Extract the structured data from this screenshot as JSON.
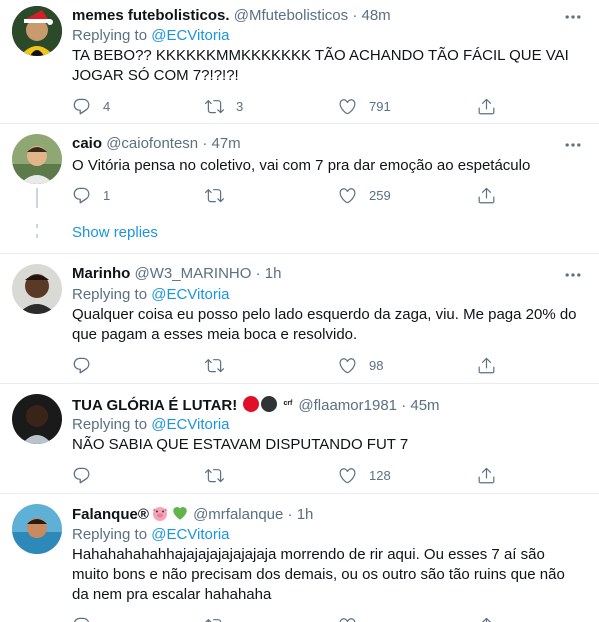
{
  "tweets": [
    {
      "name": "memes futebolisticos.",
      "handle": "@Mfutebolisticos",
      "sep": "·",
      "time": "48m",
      "replying_label": "Replying to",
      "replying_to": "@ECVitoria",
      "text_lines": [
        "TA BEBO?? KKKKKKMMKKKKKKK TÃO ACHANDO TÃO FÁCIL QUE VAI",
        "JOGAR SÓ COM 7?!?!?!"
      ],
      "replies": "4",
      "retweets": "3",
      "likes": "791"
    },
    {
      "name": "caio",
      "handle": "@caiofontesn",
      "sep": "·",
      "time": "47m",
      "text_lines": [
        "O Vitória pensa no coletivo, vai com 7 pra dar emoção ao espetáculo"
      ],
      "replies": "1",
      "retweets": "",
      "likes": "259",
      "show_replies": "Show replies"
    },
    {
      "name": "Marinho",
      "handle": "@W3_MARINHO",
      "sep": "·",
      "time": "1h",
      "replying_label": "Replying to",
      "replying_to": "@ECVitoria",
      "text_lines": [
        "Qualquer coisa eu posso pelo lado esquerdo da zaga, viu. Me paga 20% do",
        "que pagam a esses meia boca e resolvido."
      ],
      "replies": "",
      "retweets": "",
      "likes": "98"
    },
    {
      "name": "TUA GLÓRIA É LUTAR!",
      "name_badge_text": "crf",
      "handle": "@flaamor1981",
      "sep": "·",
      "time": "45m",
      "replying_label": "Replying to",
      "replying_to": "@ECVitoria",
      "text_lines": [
        "NÃO SABIA QUE ESTAVAM DISPUTANDO FUT 7"
      ],
      "replies": "",
      "retweets": "",
      "likes": "128"
    },
    {
      "name": "Falanque®",
      "handle": "@mrfalanque",
      "sep": "·",
      "time": "1h",
      "replying_label": "Replying to",
      "replying_to": "@ECVitoria",
      "text_lines": [
        "Hahahahahahhajajajajajajajaja morrendo de rir aqui. Ou esses 7 aí são",
        "muito bons e não precisam dos demais, ou os outro são tão ruins que não",
        "da nem pra escalar hahahaha"
      ],
      "replies": "",
      "retweets": "",
      "likes": ""
    }
  ],
  "colors": {
    "accent": "#1b95e0",
    "secondary_text": "#5b7083",
    "border": "#e6ecf0",
    "badge_red": "#e0102a",
    "badge_black": "#2f3336",
    "pig": "#f4a6b8",
    "heart_green": "#5fb54a"
  },
  "icons": [
    "reply-icon",
    "retweet-icon",
    "like-icon",
    "share-icon",
    "more-icon"
  ]
}
